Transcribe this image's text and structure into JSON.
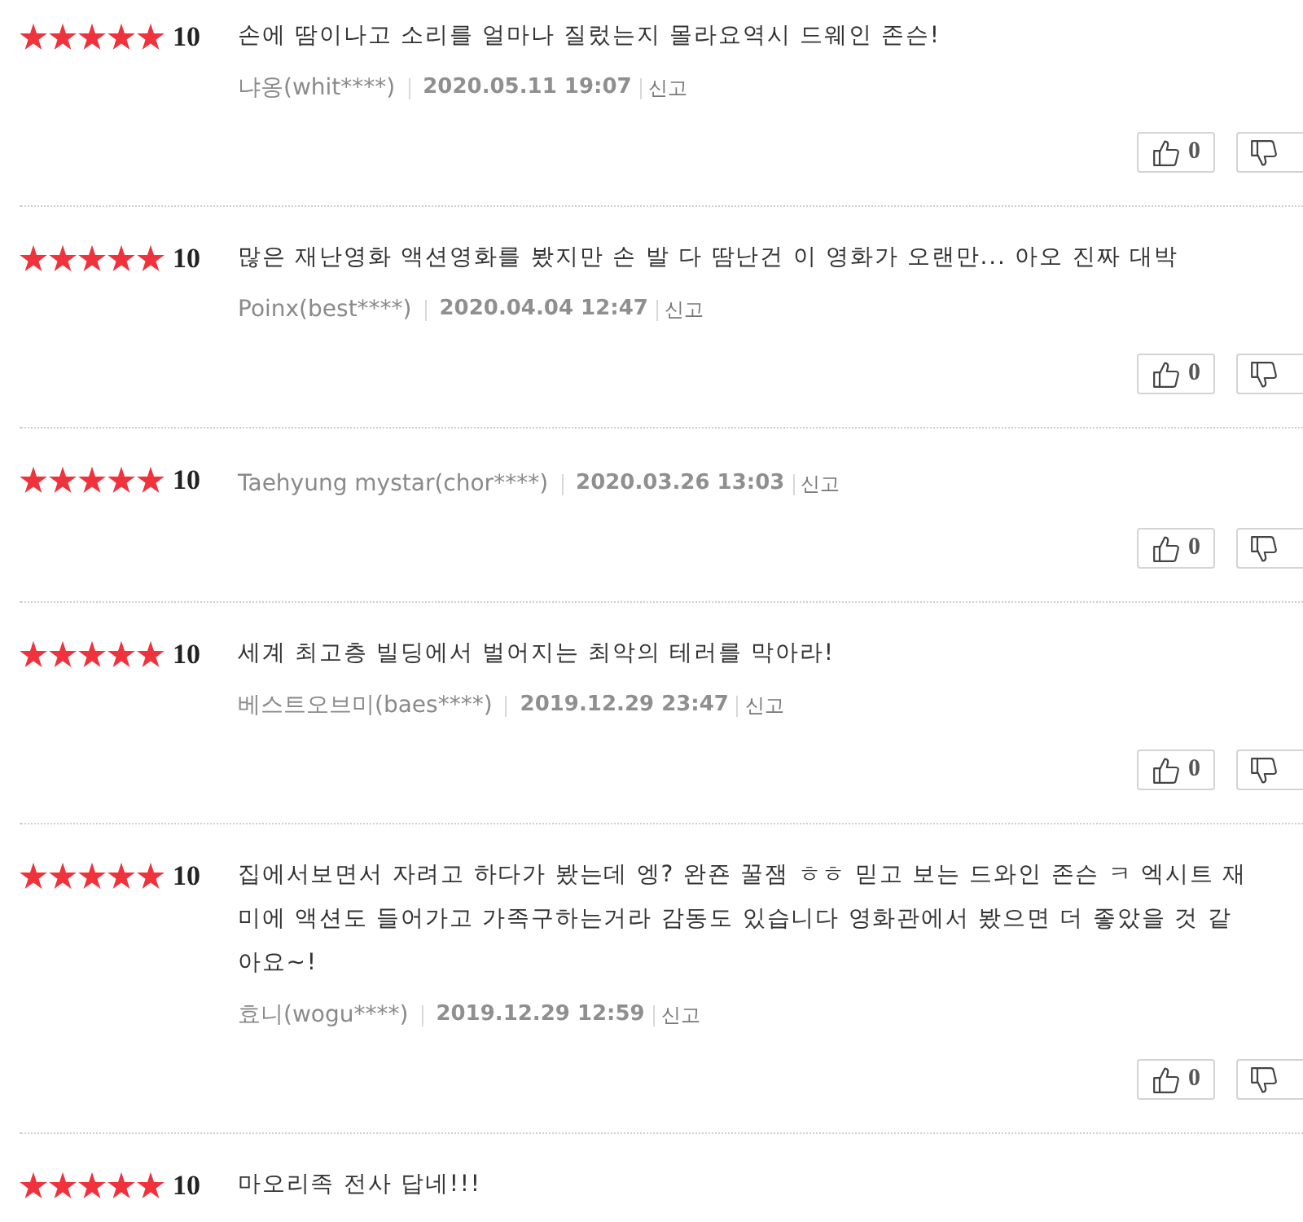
{
  "reviews": [
    {
      "stars": 5,
      "score": "10",
      "text": "손에 땀이나고 소리를 얼마나 질렀는지 몰라요역시 드웨인 존슨!",
      "author": "냐옹(whit****)",
      "date": "2020.05.11 19:07",
      "report": "신고",
      "likes": "0"
    },
    {
      "stars": 5,
      "score": "10",
      "text": "많은 재난영화 액션영화를 봤지만 손 발 다 땀난건 이 영화가 오랜만... 아오 진짜 대박",
      "author": "Poinx(best****)",
      "date": "2020.04.04 12:47",
      "report": "신고",
      "likes": "0"
    },
    {
      "stars": 5,
      "score": "10",
      "author": "Taehyung mystar(chor****)",
      "date": "2020.03.26 13:03",
      "report": "신고",
      "likes": "0"
    },
    {
      "stars": 5,
      "score": "10",
      "text": "세계 최고층 빌딩에서 벌어지는 최악의 테러를 막아라!",
      "author": "베스트오브미(baes****)",
      "date": "2019.12.29 23:47",
      "report": "신고",
      "likes": "0"
    },
    {
      "stars": 5,
      "score": "10",
      "text": "집에서보면서 자려고 하다가 봤는데 엥? 완죤 꿀잼 ㅎㅎ 믿고 보는 드와인 존슨 ㅋ 엑시트 재미에 액션도 들어가고 가족구하는거라 감동도 있습니다 영화관에서 봤으면 더 좋았을 것 같아요~!",
      "author": "효니(wogu****)",
      "date": "2019.12.29 12:59",
      "report": "신고",
      "likes": "0"
    },
    {
      "stars": 5,
      "score": "10",
      "text": "마오리족 전사 답네!!!"
    }
  ]
}
